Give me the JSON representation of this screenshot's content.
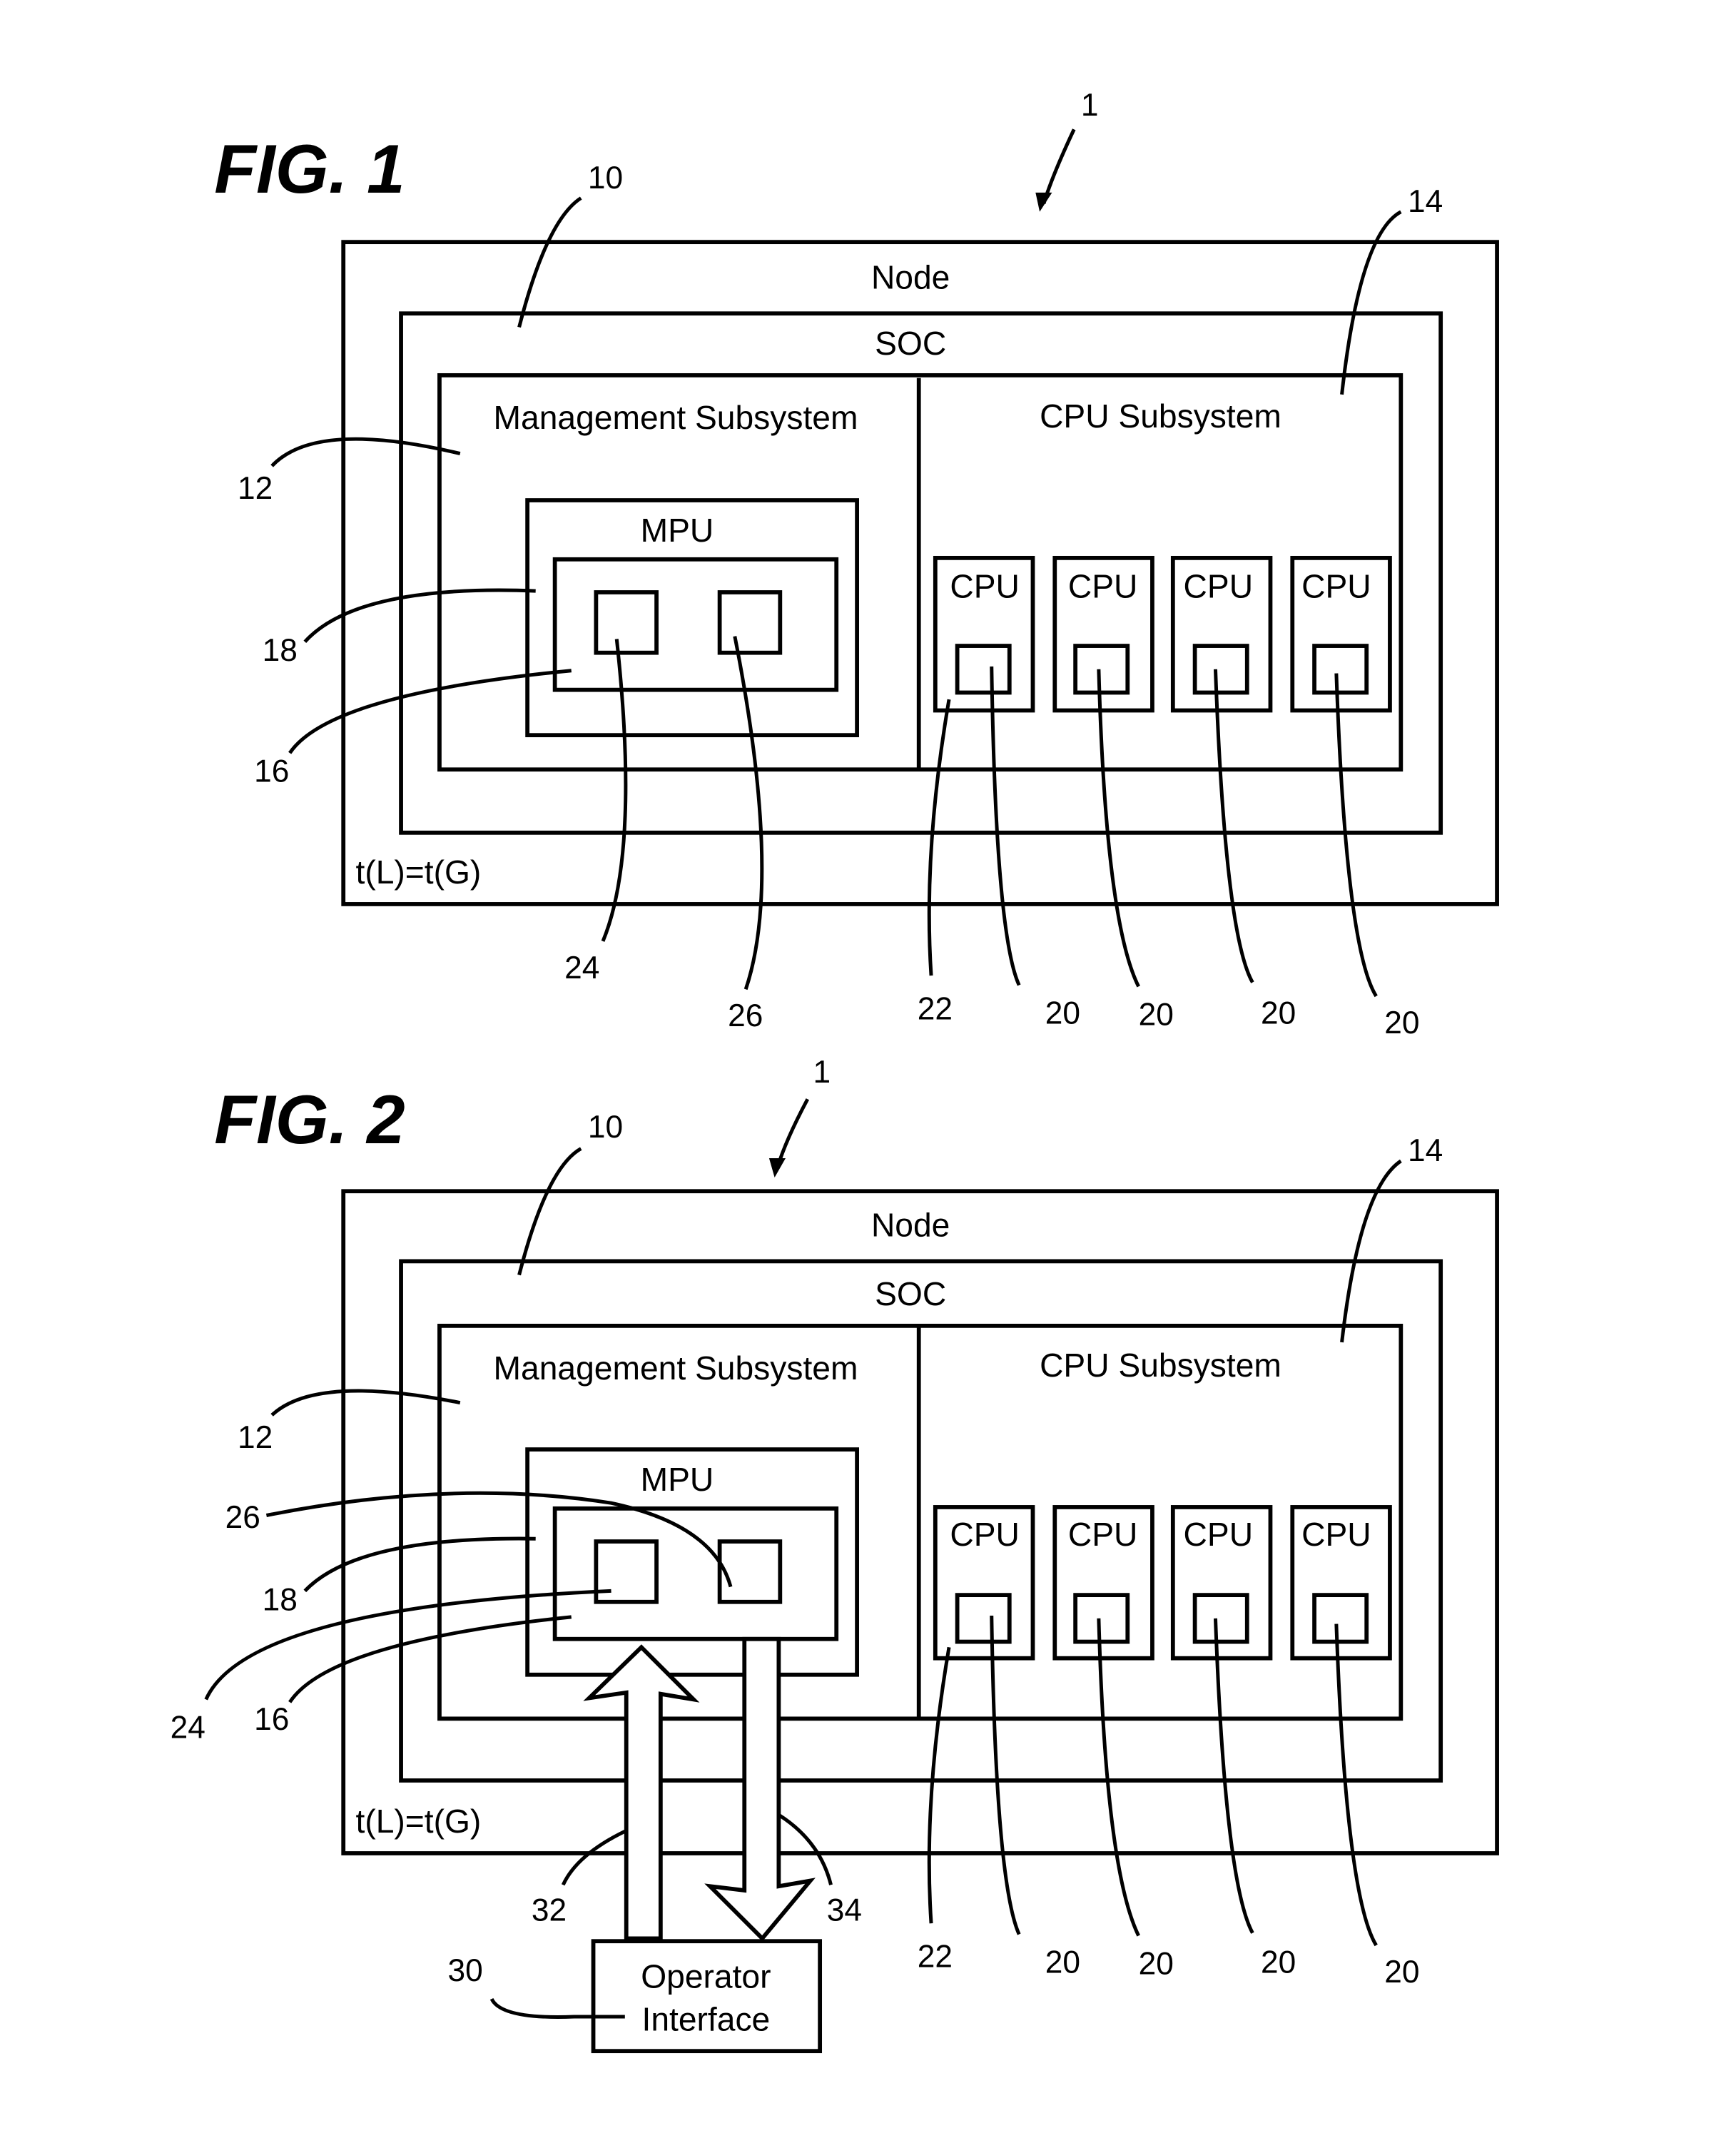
{
  "figures": [
    {
      "title": "FIG. 1",
      "node_label": "Node",
      "soc_label": "SOC",
      "management_label": "Management Subsystem",
      "cpu_subsystem_label": "CPU Subsystem",
      "mpu_label": "MPU",
      "cpu_labels": [
        "CPU",
        "CPU",
        "CPU",
        "CPU"
      ],
      "time_equation": "t(L)=t(G)",
      "refs": {
        "system": "1",
        "soc": "10",
        "management": "12",
        "cpu_subsystem": "14",
        "mpu_core": "16",
        "mpu": "18",
        "cpu_clocks": [
          "20",
          "20",
          "20",
          "20"
        ],
        "cpu": "22",
        "block_24": "24",
        "block_26": "26"
      }
    },
    {
      "title": "FIG. 2",
      "node_label": "Node",
      "soc_label": "SOC",
      "management_label": "Management Subsystem",
      "cpu_subsystem_label": "CPU Subsystem",
      "mpu_label": "MPU",
      "cpu_labels": [
        "CPU",
        "CPU",
        "CPU",
        "CPU"
      ],
      "time_equation": "t(L)=t(G)",
      "operator_interface": [
        "Operator",
        "Interface"
      ],
      "refs": {
        "system": "1",
        "soc": "10",
        "management": "12",
        "cpu_subsystem": "14",
        "mpu_core": "16",
        "mpu": "18",
        "cpu_clocks": [
          "20",
          "20",
          "20",
          "20"
        ],
        "cpu": "22",
        "block_24": "24",
        "block_26": "26",
        "operator_interface": "30",
        "input_arrow": "32",
        "output_arrow": "34"
      }
    }
  ]
}
